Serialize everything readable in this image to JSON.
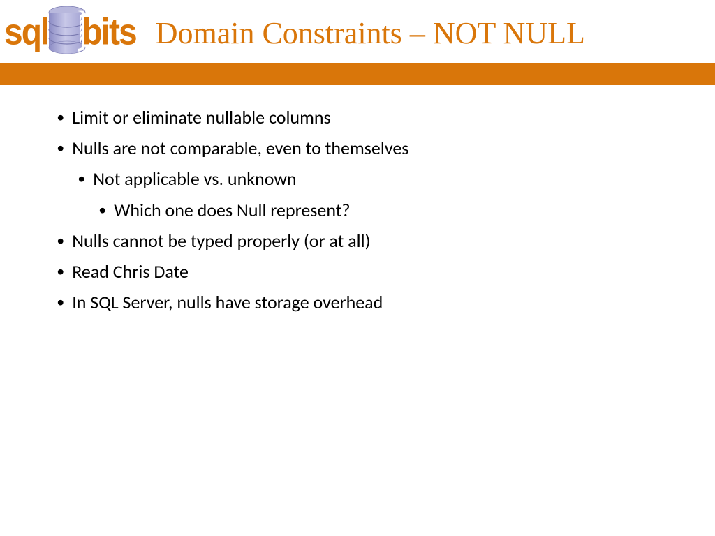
{
  "header": {
    "logo_left": "sql",
    "logo_right": "bits",
    "title": "Domain Constraints – NOT NULL"
  },
  "bullets": {
    "b1": "Limit or eliminate nullable columns",
    "b2": "Nulls are not comparable, even to themselves",
    "b2_1": "Not applicable vs. unknown",
    "b2_1_1": "Which one does Null represent?",
    "b3": "Nulls cannot be typed properly (or at all)",
    "b4": "Read Chris Date",
    "b5": "In SQL Server, nulls have storage overhead"
  }
}
